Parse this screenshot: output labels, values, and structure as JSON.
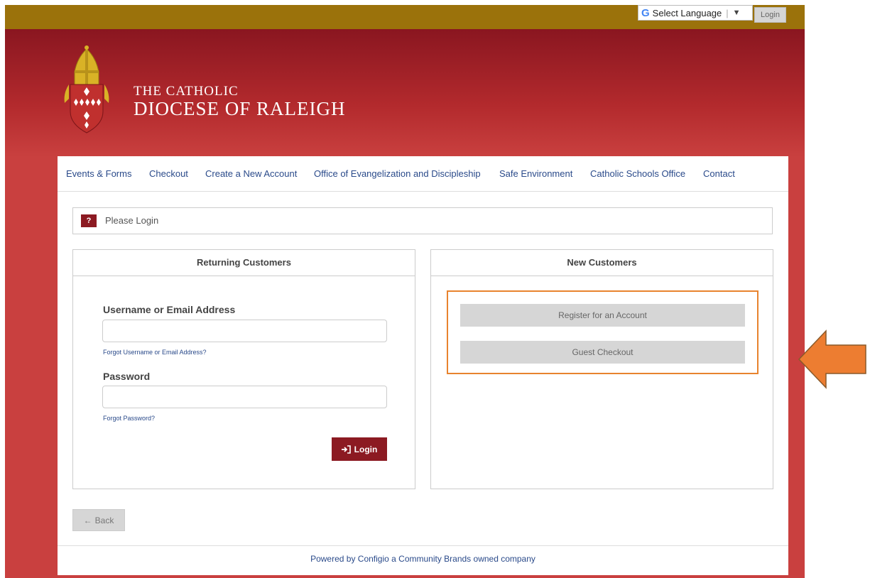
{
  "topbar": {
    "language": {
      "label": "Select Language",
      "icon": "google-g-icon",
      "dropdown_glyph": "▼"
    },
    "login_label": "Login"
  },
  "brand": {
    "line1": "THE CATHOLIC",
    "line2": "DIOCESE OF RALEIGH"
  },
  "nav": {
    "items": [
      {
        "label": "Events & Forms"
      },
      {
        "label": "Checkout"
      },
      {
        "label": "Create a New Account"
      },
      {
        "label": "Office of Evangelization and Discipleship"
      },
      {
        "label": "Safe Environment"
      },
      {
        "label": "Catholic Schools Office"
      },
      {
        "label": "Contact"
      }
    ]
  },
  "notice": {
    "badge": "?",
    "text": "Please Login"
  },
  "returning": {
    "title": "Returning Customers",
    "username_label": "Username or Email Address",
    "forgot_username": "Forgot Username or Email Address?",
    "password_label": "Password",
    "forgot_password": "Forgot Password?",
    "login_button": "Login"
  },
  "new_customers": {
    "title": "New Customers",
    "register_button": "Register for an Account",
    "guest_button": "Guest Checkout"
  },
  "back_label": "Back",
  "footer": {
    "text": "Powered by Configio a Community Brands owned company"
  },
  "colors": {
    "topbar": "#9b720b",
    "header_dark": "#8a1620",
    "header_light": "#c9403f",
    "accent": "#8c1a22",
    "link": "#2a4a8a",
    "highlight": "#e8832e"
  }
}
